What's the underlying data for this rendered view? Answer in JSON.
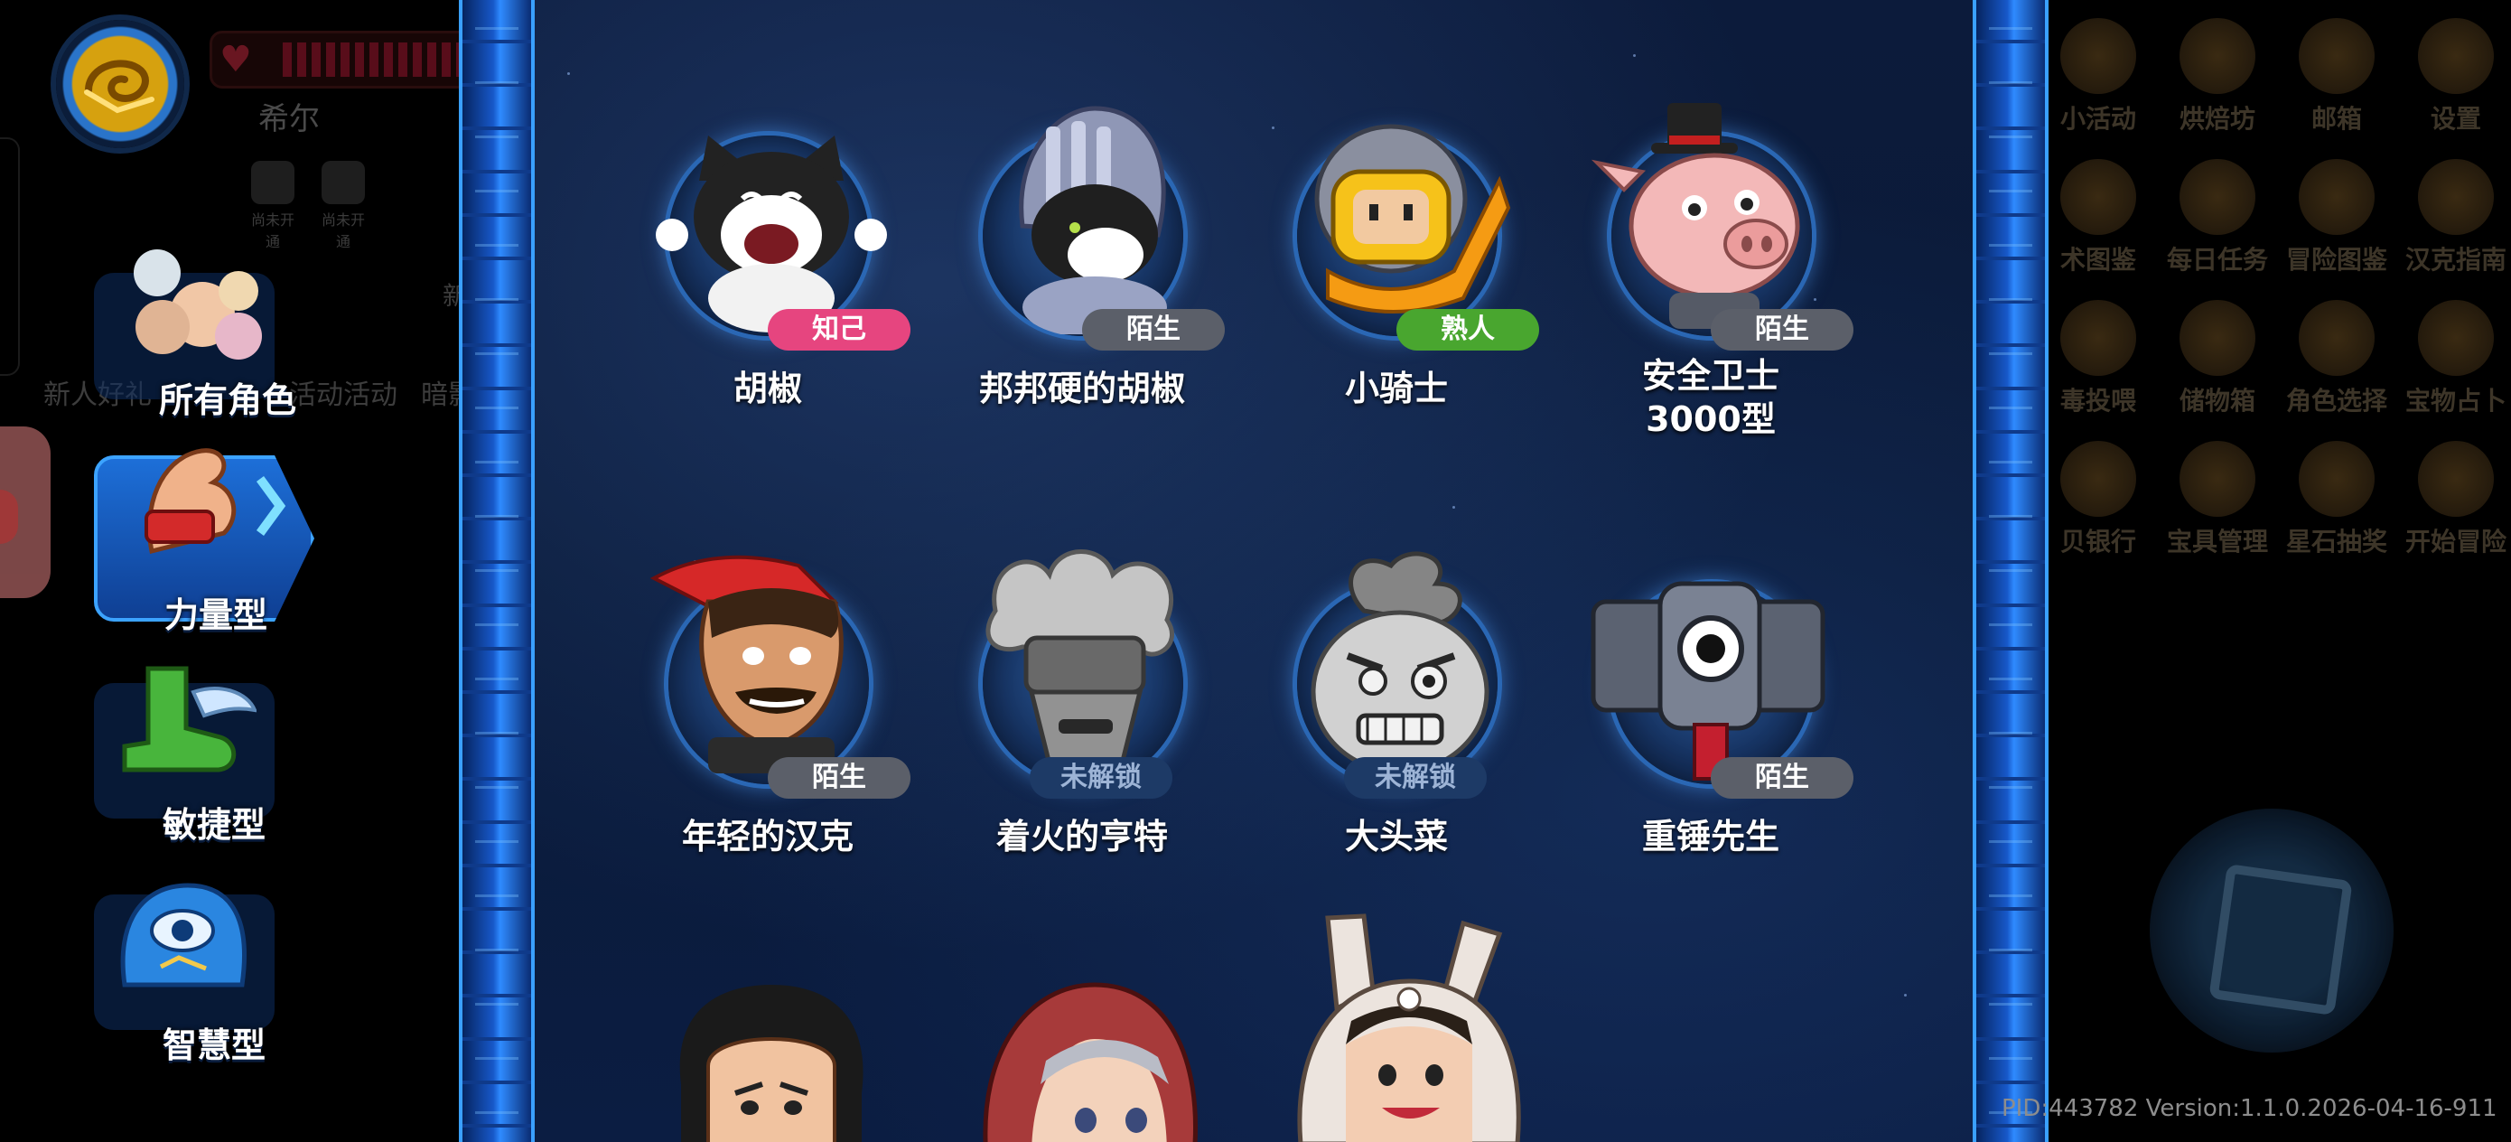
{
  "player": {
    "name": "希尔",
    "locked_slots": [
      "尚未开通",
      "尚未开通"
    ]
  },
  "left_dim_labels": [
    "新人好礼",
    "活动活动",
    "暗影魔"
  ],
  "left_dim_new": "新玩",
  "categories": [
    {
      "label": "所有角色",
      "active": false
    },
    {
      "label": "力量型",
      "active": true
    },
    {
      "label": "敏捷型",
      "active": false
    },
    {
      "label": "智慧型",
      "active": false
    }
  ],
  "characters": [
    {
      "name": "胡椒",
      "status": "知己",
      "status_kind": "self"
    },
    {
      "name": "邦邦硬的胡椒",
      "status": "陌生",
      "status_kind": "stranger"
    },
    {
      "name": "小骑士",
      "status": "熟人",
      "status_kind": "friend"
    },
    {
      "name": "安全卫士\n3000型",
      "status": "陌生",
      "status_kind": "stranger"
    },
    {
      "name": "年轻的汉克",
      "status": "陌生",
      "status_kind": "stranger"
    },
    {
      "name": "着火的亨特",
      "status": "未解锁",
      "status_kind": "locked"
    },
    {
      "name": "大头菜",
      "status": "未解锁",
      "status_kind": "locked"
    },
    {
      "name": "重锤先生",
      "status": "陌生",
      "status_kind": "stranger"
    }
  ],
  "right_menu": [
    [
      "小活动",
      "烘焙坊",
      "邮箱",
      "设置"
    ],
    [
      "术图鉴",
      "每日任务",
      "冒险图鉴",
      "汉克指南"
    ],
    [
      "毒投喂",
      "储物箱",
      "角色选择",
      "宝物占卜"
    ],
    [
      "贝银行",
      "宝具管理",
      "星石抽奖",
      "开始冒险"
    ]
  ],
  "version_text": "PID:443782  Version:1.1.0.2026-04-16-911",
  "colors": {
    "badge_self": "#e6457f",
    "badge_friend": "#49a62f",
    "badge_stranger": "#5b5f69",
    "badge_locked": "#1d3a66",
    "panel_border": "#2f8bff"
  }
}
